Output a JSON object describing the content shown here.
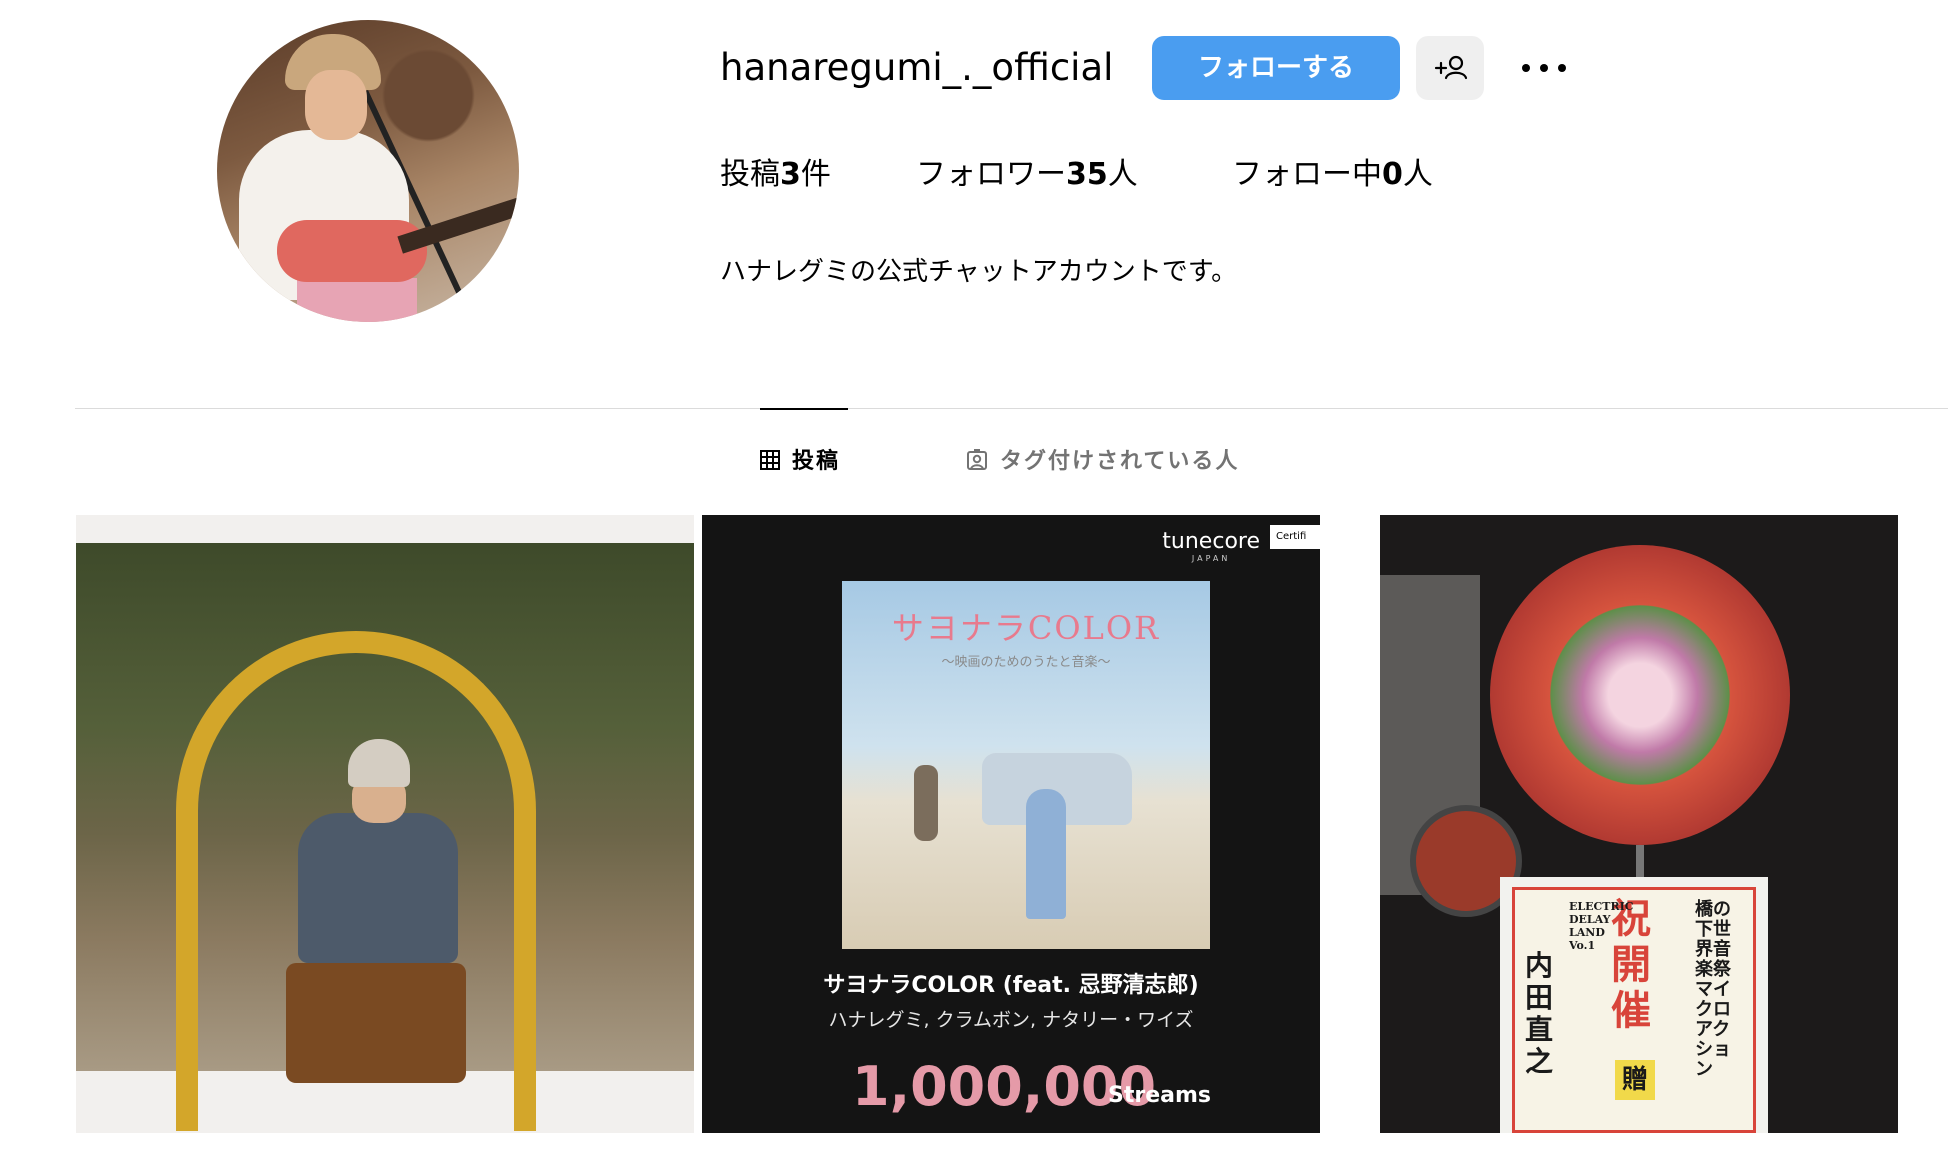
{
  "profile": {
    "username": "hanaregumi_._official",
    "follow_label": "フォローする",
    "suggest_icon": "add-person-icon",
    "more_icon": "more-options-icon",
    "stats": {
      "posts_label": "投稿",
      "posts_count": "3",
      "posts_suffix": "件",
      "followers_label": "フォロワー",
      "followers_count": "35",
      "followers_suffix": "人",
      "following_label": "フォロー中",
      "following_count": "0",
      "following_suffix": "人"
    },
    "bio": "ハナレグミの公式チャットアカウントです。"
  },
  "tabs": [
    {
      "label": "投稿",
      "icon": "grid-icon",
      "active": true
    },
    {
      "label": "タグ付けされている人",
      "icon": "tagged-icon",
      "active": false
    }
  ],
  "posts": [
    {
      "kind": "photo"
    },
    {
      "kind": "streaming-certificate",
      "brand": "tunecore",
      "brand_sub": "JAPAN",
      "cert_label": "Certifi",
      "cover_title": "サヨナラCOLOR",
      "cover_subtitle": "〜映画のためのうたと音楽〜",
      "song": "サヨナラCOLOR (feat. 忌野清志郎)",
      "artists": "ハナレグミ, クラムボン, ナタリー・ワイズ",
      "streams": "1,000,000",
      "streams_label": "Streams"
    },
    {
      "kind": "photo",
      "sign_main": "祝開催",
      "sign_right": "橋の下世界音楽祭 マイクロアクション",
      "sign_left": "内田直之",
      "sign_tag": "ELECTRIC DELAY LAND Vo.1",
      "sign_gift": "贈"
    }
  ],
  "colors": {
    "accent": "#4a9df0",
    "divider": "#dbdbdb",
    "muted": "#737373"
  }
}
